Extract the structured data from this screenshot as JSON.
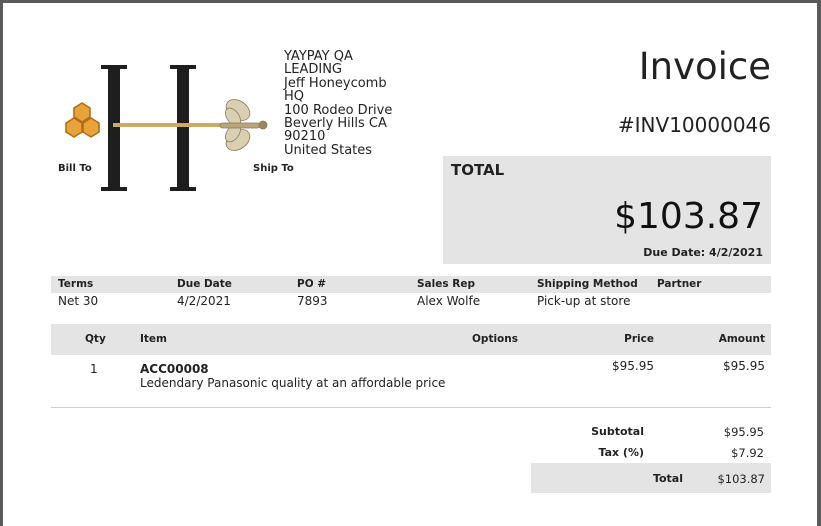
{
  "company": {
    "name_line1": "YAYPAY QA",
    "name_line2": "LEADING",
    "contact": "Jeff Honeycomb",
    "site": "HQ",
    "street": "100 Rodeo Drive",
    "city_state": "Beverly Hills CA",
    "zip": "90210",
    "country": "United States"
  },
  "labels": {
    "bill_to": "Bill To",
    "ship_to": "Ship To"
  },
  "invoice": {
    "title": "Invoice",
    "number": "#INV10000046",
    "total_label": "TOTAL",
    "total_amount": "$103.87",
    "due_date": "Due Date: 4/2/2021"
  },
  "terms_table": {
    "headers": [
      "Terms",
      "Due Date",
      "PO #",
      "Sales Rep",
      "Shipping Method",
      "Partner"
    ],
    "values": [
      "Net 30",
      "4/2/2021",
      "7893",
      "Alex Wolfe",
      "Pick-up at store",
      ""
    ]
  },
  "items_table": {
    "headers": [
      "Qty",
      "Item",
      "Options",
      "Price",
      "Amount"
    ],
    "rows": [
      {
        "qty": "1",
        "sku": "ACC00008",
        "description": "Ledendary Panasonic quality at an affordable price",
        "options": "",
        "price": "$95.95",
        "amount": "$95.95"
      }
    ]
  },
  "summary": {
    "subtotal_label": "Subtotal",
    "subtotal": "$95.95",
    "tax_label": "Tax (%)",
    "tax": "$7.92",
    "total_label": "Total",
    "total": "$103.87"
  },
  "colors": {
    "header_bg": "#e4e4e4",
    "logo_gold": "#c9a96e",
    "honey": "#e8a33a",
    "logo_dark": "#1e1e1e"
  }
}
